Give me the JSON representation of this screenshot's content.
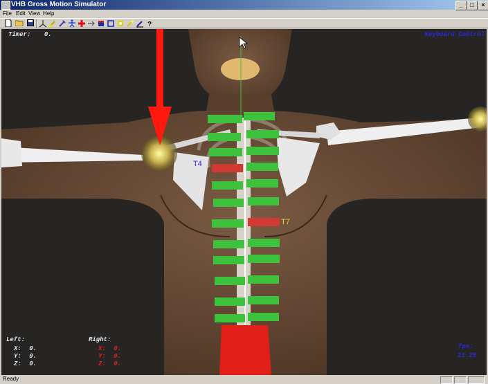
{
  "window": {
    "title": "VHB Gross Motion Simulator"
  },
  "menu": {
    "items": [
      "File",
      "Edit",
      "View",
      "Help"
    ]
  },
  "toolbar": {
    "icons": [
      "new-file-icon",
      "open-folder-icon",
      "save-icon",
      "axes-icon",
      "paint-icon",
      "pin-icon",
      "figure-icon",
      "red-cross-icon",
      "arrow-icon",
      "flag-icon",
      "square-icon",
      "sphere-icon",
      "sparkle-icon",
      "pen-icon",
      "help-icon"
    ]
  },
  "hud": {
    "timer_label": "Timer:",
    "timer_value": "0.",
    "mode": "Keyboard Control",
    "left_label": "Left:",
    "right_label": "Right:",
    "left": {
      "x_label": "X:",
      "x": "0.",
      "y_label": "Y:",
      "y": "0.",
      "z_label": "Z:",
      "z": "0."
    },
    "right": {
      "x_label": "X:",
      "x": "0.",
      "y_label": "Y:",
      "y": "0.",
      "z_label": "Z:",
      "z": "0."
    },
    "fps_label": "fps:",
    "fps_value": "11.25"
  },
  "labels": {
    "t4": "T4",
    "t7": "T7"
  },
  "colors": {
    "vertebra_normal": "#3ec23e",
    "vertebra_selected": "#d03a32",
    "force_arrow": "#ff1a10",
    "hud_blue": "#2a2ad8",
    "hud_red": "#e02020",
    "t7_label": "#e8d040"
  },
  "status": {
    "text": "Ready"
  }
}
